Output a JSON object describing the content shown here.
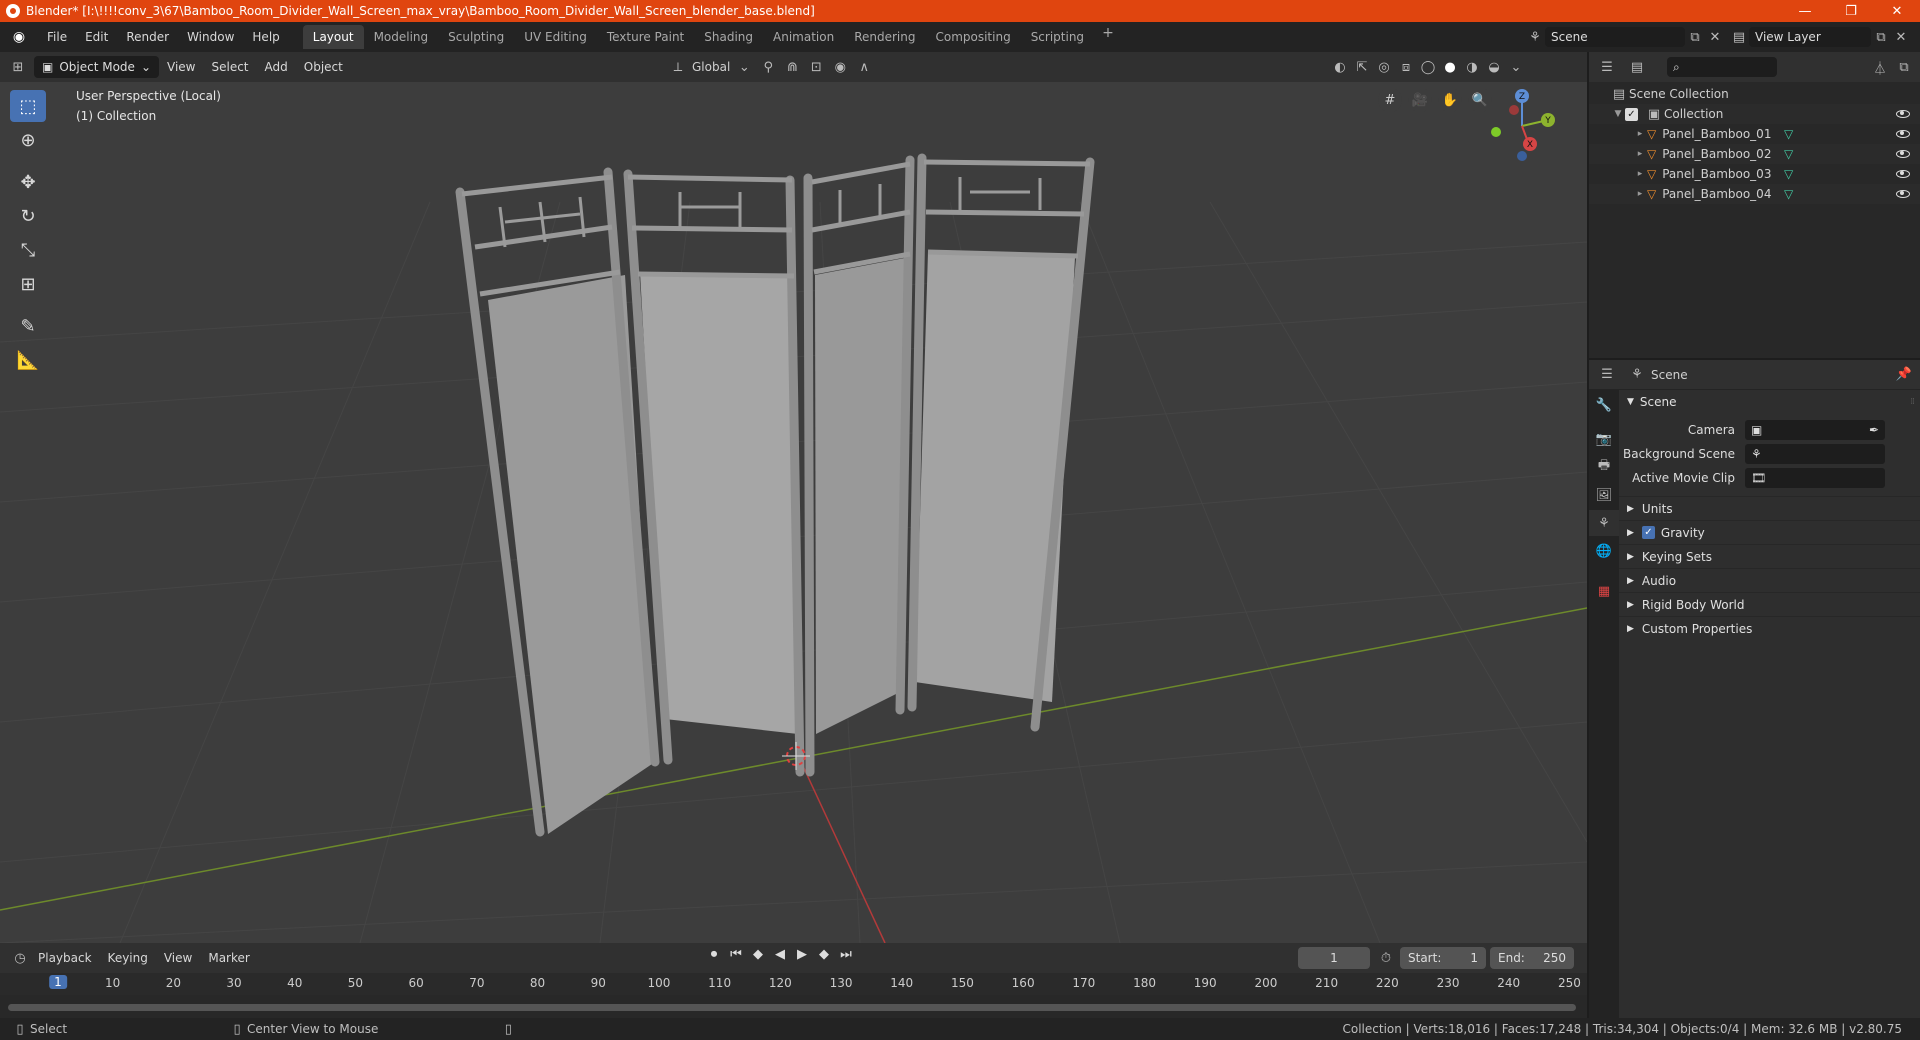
{
  "window": {
    "title": "Blender* [I:\\!!!!conv_3\\67\\Bamboo_Room_Divider_Wall_Screen_max_vray\\Bamboo_Room_Divider_Wall_Screen_blender_base.blend]",
    "minimize": "—",
    "maximize": "❐",
    "close": "✕"
  },
  "menu": [
    "File",
    "Edit",
    "Render",
    "Window",
    "Help"
  ],
  "workspaces": [
    "Layout",
    "Modeling",
    "Sculpting",
    "UV Editing",
    "Texture Paint",
    "Shading",
    "Animation",
    "Rendering",
    "Compositing",
    "Scripting"
  ],
  "active_workspace": "Layout",
  "scene_selector": "Scene",
  "view_layer_selector": "View Layer",
  "viewport_header": {
    "mode": "Object Mode",
    "menus": [
      "View",
      "Select",
      "Add",
      "Object"
    ],
    "transform_orientation": "Global"
  },
  "viewport": {
    "perspective_label": "User Perspective (Local)",
    "collection_label": "(1) Collection",
    "gizmo_axes": [
      "Z",
      "Y",
      "X"
    ]
  },
  "outliner": {
    "root": "Scene Collection",
    "collection": "Collection",
    "objects": [
      "Panel_Bamboo_01",
      "Panel_Bamboo_02",
      "Panel_Bamboo_03",
      "Panel_Bamboo_04"
    ]
  },
  "properties": {
    "header_title": "Scene",
    "panel_title": "Scene",
    "fields": [
      {
        "label": "Camera",
        "value": ""
      },
      {
        "label": "Background Scene",
        "value": ""
      },
      {
        "label": "Active Movie Clip",
        "value": ""
      }
    ],
    "subpanels": [
      "Units",
      "Gravity",
      "Keying Sets",
      "Audio",
      "Rigid Body World",
      "Custom Properties"
    ]
  },
  "timeline": {
    "menus": [
      "Playback",
      "Keying",
      "View",
      "Marker"
    ],
    "current_frame": "1",
    "start_label": "Start:",
    "start": "1",
    "end_label": "End:",
    "end": "250",
    "ruler_ticks": [
      "1",
      "10",
      "20",
      "30",
      "40",
      "50",
      "60",
      "70",
      "80",
      "90",
      "100",
      "110",
      "120",
      "130",
      "140",
      "150",
      "160",
      "170",
      "180",
      "190",
      "200",
      "210",
      "220",
      "230",
      "240",
      "250"
    ]
  },
  "statusbar": {
    "left_action": "Select",
    "middle_action": "Center View to Mouse",
    "stats": "Collection | Verts:18,016 | Faces:17,248 | Tris:34,304 | Objects:0/4 | Mem: 32.6 MB | v2.80.75"
  },
  "colors": {
    "accent": "#4772b3",
    "titlebar": "#e0450f",
    "object_orange": "#e88a2e",
    "mesh_teal": "#42c9a2"
  }
}
